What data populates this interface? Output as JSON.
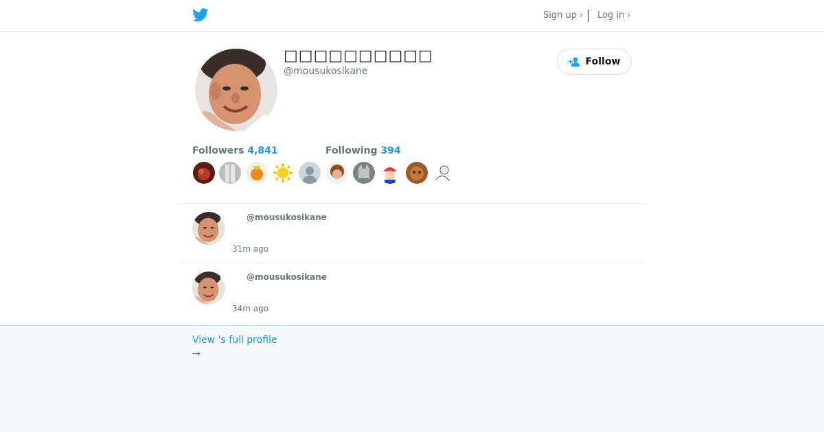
{
  "header": {
    "logo": "twitter-bird-icon",
    "signup_label": "Sign up ›",
    "login_label": "Log in ›"
  },
  "profile": {
    "display_name": "□□□□□□□□□□",
    "handle": "@mousukosikane",
    "follow_label": "Follow",
    "followers_label": "Followers",
    "followers_count": "4,841",
    "following_label": "Following",
    "following_count": "394"
  },
  "tweets": [
    {
      "handle": "@mousukosikane",
      "time": "31m ago"
    },
    {
      "handle": "@mousukosikane",
      "time": "34m ago"
    }
  ],
  "footer": {
    "view_profile_label": "View 's full profile",
    "arrow": "→"
  },
  "colors": {
    "brand_blue": "#1da1f2",
    "link_blue": "#1b95e0",
    "muted_text": "#657786",
    "footer_bg": "#f5f8fa"
  }
}
